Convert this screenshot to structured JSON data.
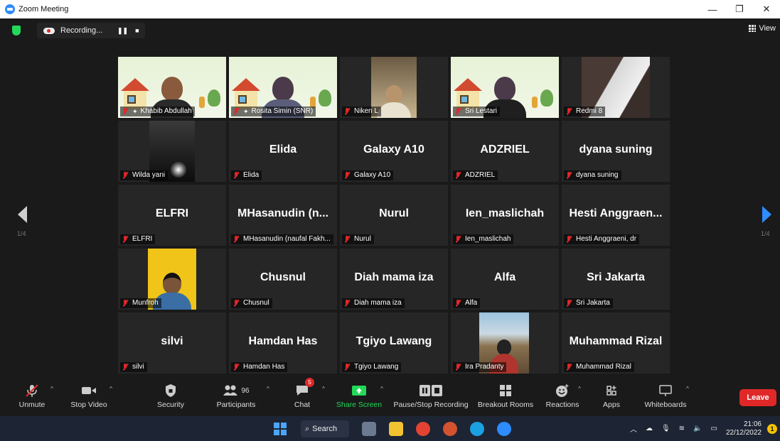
{
  "window": {
    "title": "Zoom Meeting",
    "controls": {
      "minimize": "—",
      "restore": "❐",
      "close": "✕"
    }
  },
  "top": {
    "recording_label": "Recording...",
    "view_label": "View"
  },
  "pagination": {
    "left": "1/4",
    "right": "1/4"
  },
  "participants": [
    {
      "big": "",
      "label": "Khabib Abdullah",
      "video": "scene",
      "pinned": true
    },
    {
      "big": "",
      "label": "Rosita Simin (SNR)",
      "video": "scene",
      "pinned": true
    },
    {
      "big": "",
      "label": "Niken L",
      "video": "room"
    },
    {
      "big": "",
      "label": "Sri Lestari",
      "video": "scene",
      "speaking": true
    },
    {
      "big": "",
      "label": "Redmi 8",
      "video": "door"
    },
    {
      "big": "",
      "label": "Wilda yani",
      "video": "dark"
    },
    {
      "big": "Elida",
      "label": "Elida"
    },
    {
      "big": "Galaxy A10",
      "label": "Galaxy A10"
    },
    {
      "big": "ADZRIEL",
      "label": "ADZRIEL"
    },
    {
      "big": "dyana suning",
      "label": "dyana suning"
    },
    {
      "big": "ELFRI",
      "label": "ELFRI"
    },
    {
      "big": "MHasanudin  (n...",
      "label": "MHasanudin (naufal Fakh..."
    },
    {
      "big": "Nurul",
      "label": "Nurul"
    },
    {
      "big": "Ien_maslichah",
      "label": "Ien_maslichah"
    },
    {
      "big": "Hesti  Anggraen...",
      "label": "Hesti Anggraeni, dr"
    },
    {
      "big": "",
      "label": "Munfroh",
      "video": "yellow"
    },
    {
      "big": "Chusnul",
      "label": "Chusnul"
    },
    {
      "big": "Diah mama iza",
      "label": "Diah mama iza"
    },
    {
      "big": "Alfa",
      "label": "Alfa"
    },
    {
      "big": "Sri Jakarta",
      "label": "Sri Jakarta"
    },
    {
      "big": "silvi",
      "label": "silvi"
    },
    {
      "big": "Hamdan Has",
      "label": "Hamdan Has"
    },
    {
      "big": "Tgiyo Lawang",
      "label": "Tgiyo Lawang"
    },
    {
      "big": "",
      "label": "Ira Pradanty",
      "video": "mountain"
    },
    {
      "big": "Muhammad Rizal",
      "label": "Muhammad Rizal"
    }
  ],
  "toolbar": {
    "unmute": "Unmute",
    "stop_video": "Stop Video",
    "security": "Security",
    "participants": "Participants",
    "participants_count": "96",
    "chat": "Chat",
    "chat_badge": "5",
    "share_screen": "Share Screen",
    "pause_recording": "Pause/Stop Recording",
    "breakout": "Breakout Rooms",
    "reactions": "Reactions",
    "apps": "Apps",
    "whiteboards": "Whiteboards",
    "leave": "Leave"
  },
  "taskbar": {
    "search": "Search",
    "time": "21:06",
    "date": "22/12/2022",
    "notifications": "1"
  },
  "colors": {
    "accent_green": "#23d959",
    "leave_red": "#e02828",
    "zoom_blue": "#2d8cff",
    "speaking_yellow": "#e0f03c"
  }
}
